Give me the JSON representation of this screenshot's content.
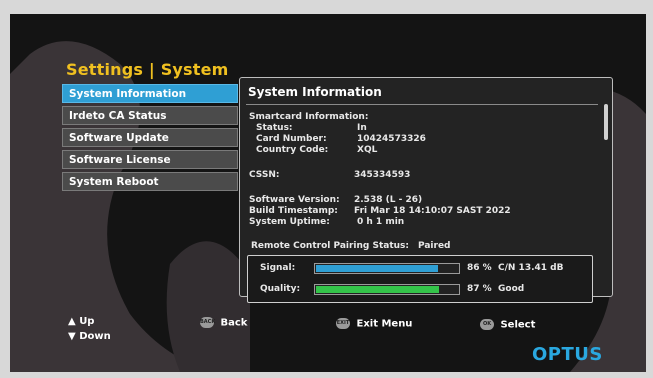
{
  "header": {
    "title": "Settings | System"
  },
  "menu": {
    "items": [
      {
        "label": "System Information",
        "active": true
      },
      {
        "label": "Irdeto CA Status",
        "active": false
      },
      {
        "label": "Software Update",
        "active": false
      },
      {
        "label": "Software License",
        "active": false
      },
      {
        "label": "System Reboot",
        "active": false
      }
    ]
  },
  "panel": {
    "title": "System Information",
    "smartcard_heading": "Smartcard Information:",
    "status_label": "Status:",
    "status_value": "In",
    "card_number_label": "Card Number:",
    "card_number_value": "10424573326",
    "country_code_label": "Country Code:",
    "country_code_value": "XQL",
    "cssn_label": "CSSN:",
    "cssn_value": "345334593",
    "software_version_label": "Software Version:",
    "software_version_value": "2.538   (L - 26)",
    "build_timestamp_label": "Build Timestamp:",
    "build_timestamp_value": "Fri Mar 18 14:10:07 SAST 2022",
    "uptime_label": "System Uptime:",
    "uptime_value": "0 h 1 min",
    "remote_pairing_label": "Remote Control Pairing Status:",
    "remote_pairing_value": "Paired",
    "signal": {
      "label": "Signal:",
      "percent_text": "86 %",
      "level": 86,
      "extra": "C/N 13.41 dB",
      "color": "#2f9fd4"
    },
    "quality": {
      "label": "Quality:",
      "percent_text": "87 %",
      "level": 87,
      "extra": "Good",
      "color": "#34c44a"
    }
  },
  "hints": {
    "up": "Up",
    "down": "Down",
    "back": "Back",
    "back_key": "BACK",
    "exit": "Exit Menu",
    "exit_key": "EXIT",
    "select": "Select",
    "select_key": "OK"
  },
  "brand": {
    "logo": "OPTUS",
    "color": "#2aa8e0"
  }
}
